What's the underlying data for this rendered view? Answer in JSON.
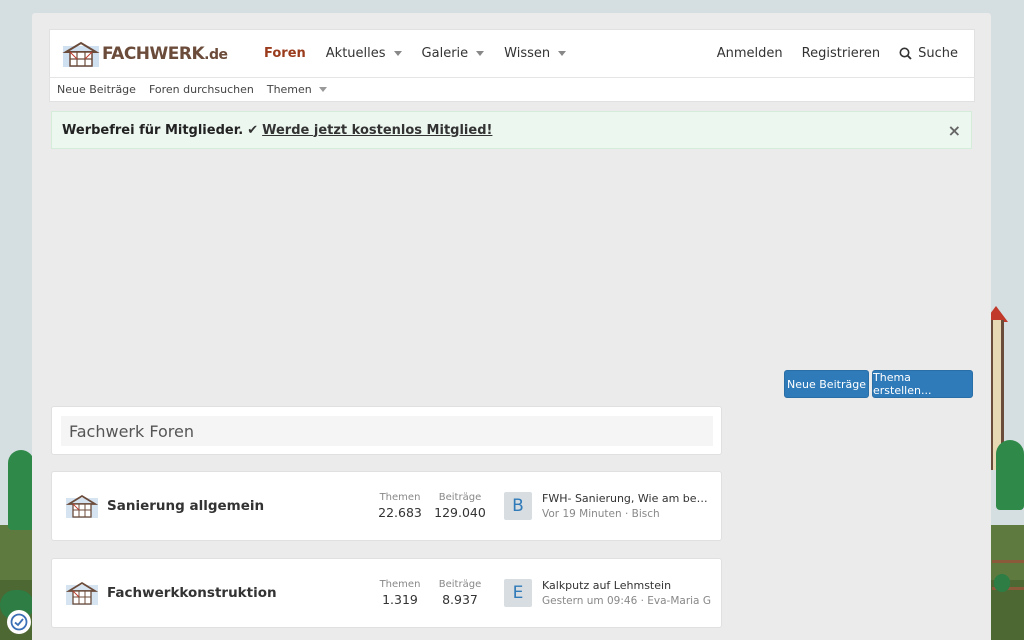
{
  "logo": {
    "text": "FACHWERK",
    "suffix": ".de"
  },
  "nav": {
    "items": [
      {
        "label": "Foren",
        "active": true
      },
      {
        "label": "Aktuelles",
        "dropdown": true
      },
      {
        "label": "Galerie",
        "dropdown": true
      },
      {
        "label": "Wissen",
        "dropdown": true
      }
    ],
    "right": {
      "login": "Anmelden",
      "register": "Registrieren",
      "search": "Suche"
    }
  },
  "subnav": {
    "new_posts": "Neue Beiträge",
    "search_forums": "Foren durchsuchen",
    "topics": "Themen"
  },
  "notice": {
    "bold": "Werbefrei für Mitglieder.",
    "check": "✔",
    "link": "Werde jetzt kostenlos Mitglied!",
    "close": "×"
  },
  "buttons": {
    "new_posts": "Neue Beiträge",
    "create_thread": "Thema erstellen..."
  },
  "forum_block": {
    "title": "Fachwerk Foren"
  },
  "forums": [
    {
      "title": "Sanierung allgemein",
      "threads_label": "Themen",
      "threads": "22.683",
      "posts_label": "Beiträge",
      "posts": "129.040",
      "avatar": "B",
      "last_title": "FWH- Sanierung, Wie am besten ...",
      "last_meta": "Vor 19 Minuten · Bisch"
    },
    {
      "title": "Fachwerkkonstruktion",
      "threads_label": "Themen",
      "threads": "1.319",
      "posts_label": "Beiträge",
      "posts": "8.937",
      "avatar": "E",
      "last_title": "Kalkputz auf Lehmstein",
      "last_meta": "Gestern um 09:46 · Eva-Maria G"
    }
  ],
  "colors": {
    "accent": "#2f7ab8",
    "active_nav": "#9a3b1c",
    "notice_bg": "#ecf7f0"
  }
}
